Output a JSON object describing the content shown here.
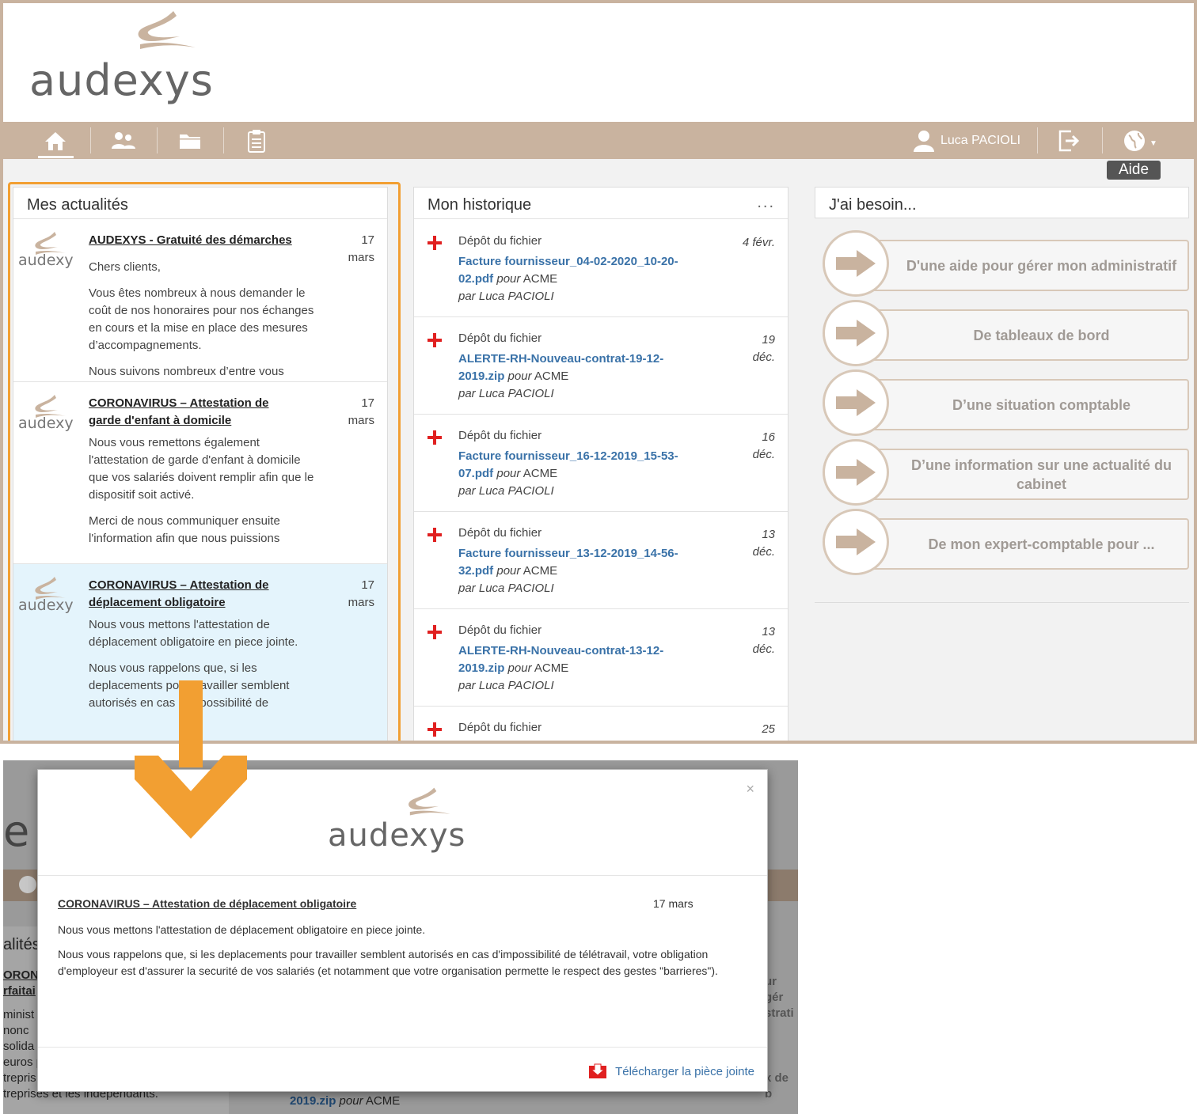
{
  "brand": {
    "logo_text": "audexys"
  },
  "nav": {
    "tabs": [
      "home",
      "clients",
      "folders",
      "tasks"
    ],
    "user_name": "Luca PACIOLI",
    "help_tooltip": "Aide"
  },
  "news": {
    "title": "Mes actualités",
    "items": [
      {
        "title": "AUDEXYS - Gratuité des démarches",
        "date": "17\nmars",
        "paragraphs": [
          "Chers clients,",
          "Vous êtes nombreux à nous demander le coût de nos honoraires pour nos échanges en cours et la mise en place des mesures d’accompagnements.",
          "Nous suivons nombreux d’entre vous"
        ]
      },
      {
        "title": "CORONAVIRUS – Attestation de garde d'enfant à domicile",
        "date": "17\nmars",
        "paragraphs": [
          "Nous vous remettons également l'attestation de garde d'enfant à domicile que vos salariés doivent remplir afin que le dispositif soit activé.",
          "Merci de nous communiquer ensuite l'information afin que nous puissions"
        ]
      },
      {
        "title": "CORONAVIRUS – Attestation de déplacement obligatoire",
        "date": "17\nmars",
        "paragraphs": [
          "Nous vous mettons l'attestation de déplacement obligatoire en piece jointe.",
          "Nous vous rappelons que, si les deplacements pour travailler semblent autorisés en cas d'impossibilité de"
        ]
      }
    ]
  },
  "history": {
    "title": "Mon historique",
    "menu": "...",
    "items": [
      {
        "action": "Dépôt du fichier",
        "file": "Facture fournisseur_04-02-2020_10-20-02.pdf",
        "pour": "pour",
        "client": "ACME",
        "by": "par Luca PACIOLI",
        "date": "4 févr."
      },
      {
        "action": "Dépôt du fichier",
        "file": "ALERTE-RH-Nouveau-contrat-19-12-2019.zip",
        "pour": "pour",
        "client": "ACME",
        "by": "par Luca PACIOLI",
        "date": "19\ndéc."
      },
      {
        "action": "Dépôt du fichier",
        "file": "Facture fournisseur_16-12-2019_15-53-07.pdf",
        "pour": "pour",
        "client": "ACME",
        "by": "par Luca PACIOLI",
        "date": "16\ndéc."
      },
      {
        "action": "Dépôt du fichier",
        "file": "Facture fournisseur_13-12-2019_14-56-32.pdf",
        "pour": "pour",
        "client": "ACME",
        "by": "par Luca PACIOLI",
        "date": "13\ndéc."
      },
      {
        "action": "Dépôt du fichier",
        "file": "ALERTE-RH-Nouveau-contrat-13-12-2019.zip",
        "pour": "pour",
        "client": "ACME",
        "by": "par Luca PACIOLI",
        "date": "13\ndéc."
      },
      {
        "action": "Dépôt du fichier",
        "file": "",
        "pour": "",
        "client": "",
        "by": "",
        "date": "25"
      }
    ]
  },
  "needs": {
    "title": "J'ai besoin...",
    "items": [
      "D'une aide pour gérer mon administratif",
      "De tableaux de bord",
      "D’une situation comptable",
      "D’une information sur une actualité du cabinet",
      "De mon expert-comptable pour ..."
    ]
  },
  "modal": {
    "logo_text": "audexys",
    "close": "×",
    "title": "CORONAVIRUS – Attestation de déplacement obligatoire",
    "date": "17 mars",
    "paragraphs": [
      "Nous vous mettons l'attestation de déplacement obligatoire en piece jointe.",
      "Nous vous rappelons que, si les deplacements pour travailler semblent autorisés en cas d'impossibilité de télétravail, votre obligation d'employeur est d'assurer la securité de vos salariés (et notamment que votre organisation permette le respect des gestes \"barrieres\")."
    ],
    "download": "Télécharger la pièce jointe"
  },
  "background": {
    "title_fragment": "alités",
    "fragments": [
      "ORONA",
      "rfaitai",
      "minist",
      "nonc",
      "solida",
      "euros p",
      "trepris",
      "treprises et les indépendants."
    ],
    "file": "2019.zip",
    "pour": "pour",
    "client": "ACME",
    "right_fragments": [
      "ur gér",
      "strati",
      "x de b"
    ]
  },
  "colors": {
    "brand": "#c9b39f",
    "highlight": "#f29f32",
    "link": "#3a72a8",
    "alert": "#e02020"
  }
}
